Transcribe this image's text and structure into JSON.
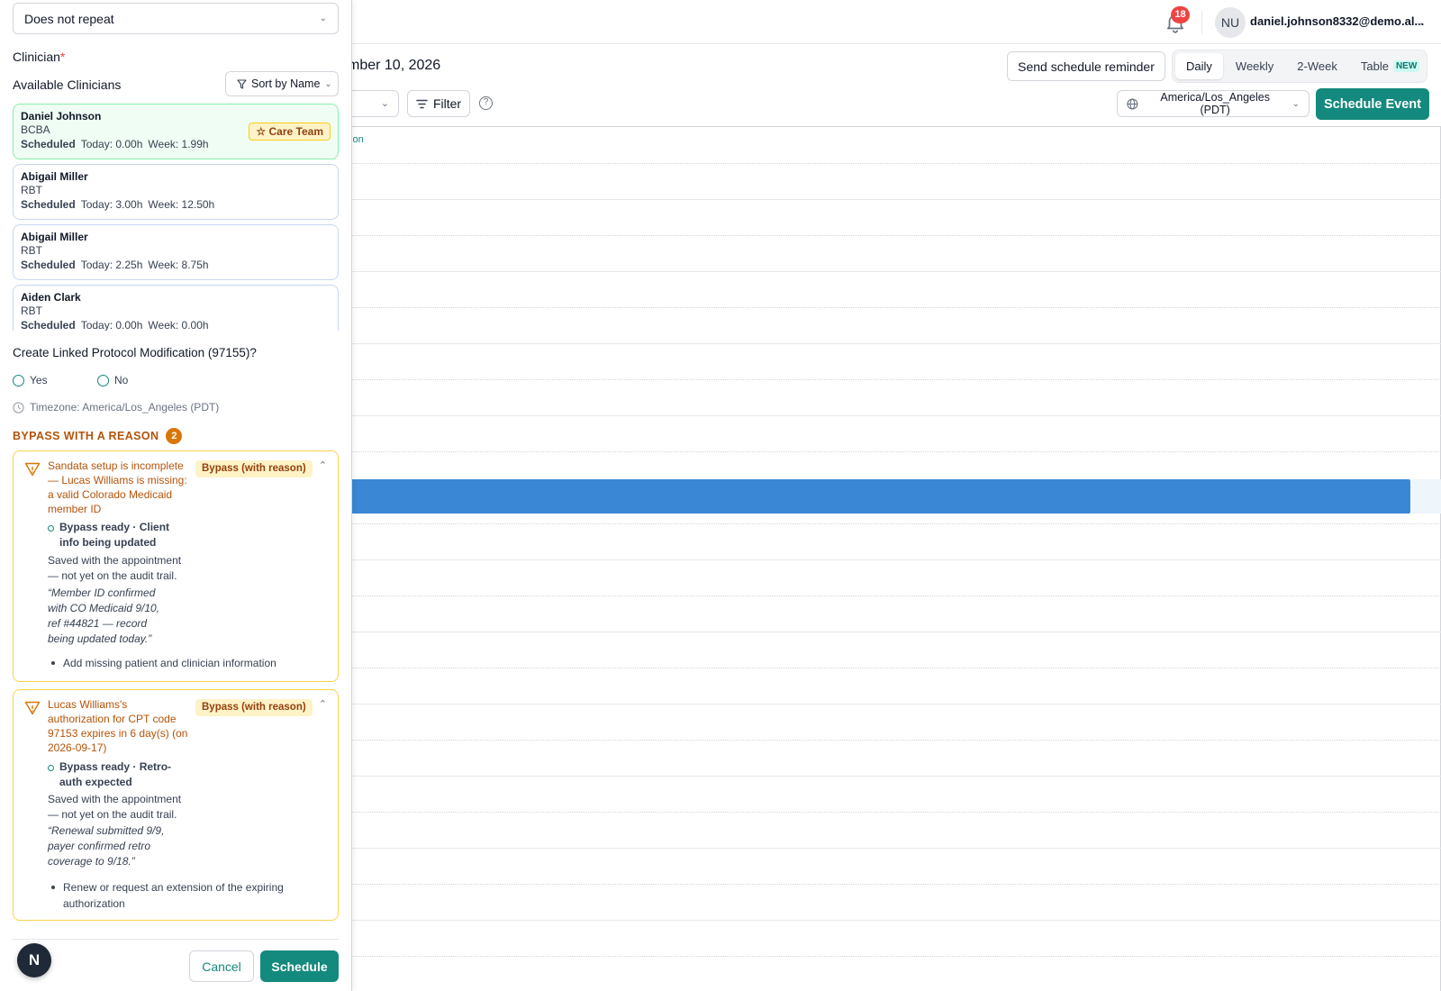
{
  "header": {
    "notification_count": "18",
    "avatar_initials": "NU",
    "user_email": "daniel.johnson8332@demo.al..."
  },
  "calendar": {
    "date_title": "mber 10, 2026",
    "send_reminder_label": "Send schedule reminder",
    "view_tabs": [
      "Daily",
      "Weekly",
      "2-Week",
      "Table"
    ],
    "active_view": "Daily",
    "table_badge": "NEW",
    "filter_label": "Filter",
    "timezone_label": "America/Los_Angeles (PDT)",
    "schedule_event_label": "Schedule Event",
    "column_header": "son",
    "accent_color": "#14897d",
    "event_color": "#3a87d6"
  },
  "drawer": {
    "repeat_value": "Does not repeat",
    "clinician_label": "Clinician",
    "required_mark": "*",
    "available_title": "Available Clinicians",
    "sort_label": "Sort by Name",
    "scheduled_label": "Scheduled",
    "clinicians": [
      {
        "name": "Daniel Johnson",
        "role": "BCBA",
        "today": "Today: 0.00h",
        "week": "Week: 1.99h",
        "badge": "☆ Care Team"
      },
      {
        "name": "Abigail Miller",
        "role": "RBT",
        "today": "Today: 3.00h",
        "week": "Week: 12.50h"
      },
      {
        "name": "Abigail Miller",
        "role": "RBT",
        "today": "Today: 2.25h",
        "week": "Week: 8.75h"
      },
      {
        "name": "Aiden Clark",
        "role": "RBT",
        "today": "Today: 0.00h",
        "week": "Week: 0.00h"
      }
    ],
    "linked_question": "Create Linked Protocol Modification (97155)?",
    "yes_label": "Yes",
    "no_label": "No",
    "timezone_note": "Timezone: America/Los_Angeles (PDT)",
    "bypass_header": "BYPASS WITH A REASON",
    "bypass_count": "2",
    "issues": [
      {
        "title": "Sandata setup is incomplete — Lucas Williams is missing: a valid Colorado Medicaid member ID",
        "pill": "Bypass (with reason)",
        "ready": "Bypass ready · Client info being updated",
        "saved": "Saved with the appointment — not yet on the audit trail.",
        "quote": "“Member ID confirmed with CO Medicaid 9/10, ref #44821 — record being updated today.”",
        "action": "Add missing patient and clinician information"
      },
      {
        "title": "Lucas Williams's authorization for CPT code 97153 expires in 6 day(s) (on 2026-09-17)",
        "pill": "Bypass (with reason)",
        "ready": "Bypass ready · Retro-auth expected",
        "saved": "Saved with the appointment — not yet on the audit trail.",
        "quote": "“Renewal submitted 9/9, payer confirmed retro coverage to 9/18.”",
        "action": "Renew or request an extension of the expiring authorization"
      }
    ],
    "logo_letter": "N",
    "cancel_label": "Cancel",
    "schedule_label": "Schedule",
    "warning_color": "#b45309"
  }
}
